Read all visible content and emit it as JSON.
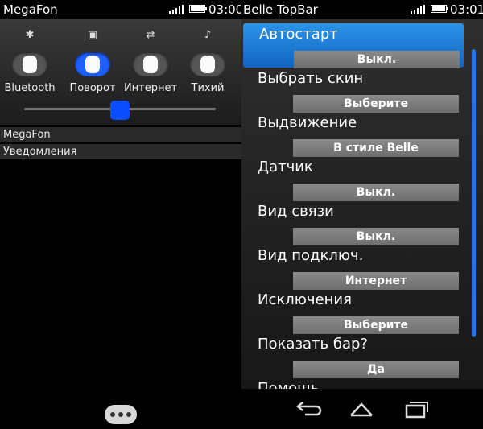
{
  "left": {
    "status": {
      "title": "MegaFon",
      "time": "03:00"
    },
    "toggles": [
      {
        "icon": "bluetooth-icon",
        "glyph": "✱",
        "label": "Bluetooth",
        "on": false
      },
      {
        "icon": "rotation-icon",
        "glyph": "▣",
        "label": "Поворот",
        "on": true
      },
      {
        "icon": "data-transfer-icon",
        "glyph": "⇄",
        "label": "Интернет",
        "on": false
      },
      {
        "icon": "silent-music-icon",
        "glyph": "♪",
        "label": "Тихий",
        "on": false
      }
    ],
    "brightness_level": 0.5,
    "notifications": [
      {
        "label": "MegaFon"
      },
      {
        "label": "Уведомления"
      }
    ],
    "menu_icon": "more-options-icon"
  },
  "right": {
    "status": {
      "title": "Belle TopBar",
      "time": "03:01"
    },
    "settings": [
      {
        "label": "Автостарт",
        "value": "Выкл.",
        "selected": true
      },
      {
        "label": "Выбрать скин",
        "value": "Выберите",
        "selected": false
      },
      {
        "label": "Выдвижение",
        "value": "В стиле Belle",
        "selected": false
      },
      {
        "label": "Датчик",
        "value": "Выкл.",
        "selected": false
      },
      {
        "label": "Вид связи",
        "value": "Выкл.",
        "selected": false
      },
      {
        "label": "Вид подключ.",
        "value": "Интернет",
        "selected": false
      },
      {
        "label": "Исключения",
        "value": "Выберите",
        "selected": false
      },
      {
        "label": "Показать бар?",
        "value": "Да",
        "selected": false
      },
      {
        "label": "Помощь",
        "value": "",
        "selected": false
      }
    ],
    "nav": [
      {
        "icon": "back-icon"
      },
      {
        "icon": "home-icon"
      },
      {
        "icon": "recent-apps-icon"
      }
    ]
  }
}
